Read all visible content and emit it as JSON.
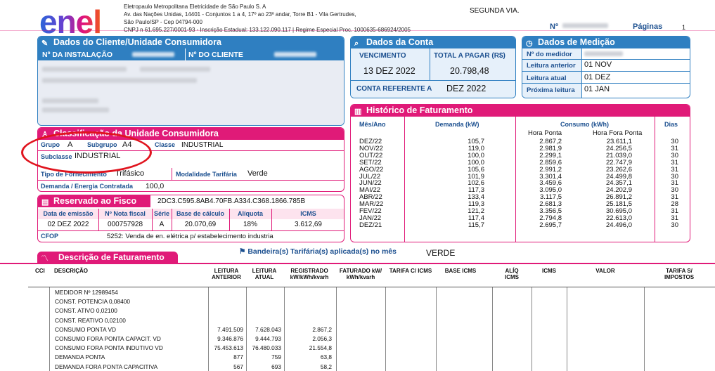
{
  "company": {
    "logo": "enel",
    "name": "Eletropaulo Metropolitana Eletricidade de São Paulo S. A",
    "address": "Av. das Nações Unidas, 14401 - Conjuntos 1 a 4, 17º ao 23º andar, Torre B1 - Vila Gertrudes,",
    "city": "São Paulo/SP - Cep 04794-000",
    "cnpj": "CNPJ n 61.695.227/0001-93 - Inscrição Estadual: 133.122.090.117 | Regime Especial Proc. 1000635-686924/2005"
  },
  "doc": {
    "segunda_via": "SEGUNDA VIA.",
    "n_label": "Nº",
    "paginas_label": "Páginas",
    "paginas_value": "1"
  },
  "cliente": {
    "title": "Dados do Cliente/Unidade Consumidora",
    "instalacao_label": "Nº DA INSTALAÇÃO",
    "cliente_label": "Nº DO CLIENTE"
  },
  "conta": {
    "title": "Dados da Conta",
    "vencimento_label": "VENCIMENTO",
    "vencimento": "13 DEZ 2022",
    "total_label": "TOTAL A PAGAR (R$)",
    "total": "20.798,48",
    "ref_label": "CONTA REFERENTE A",
    "ref": "DEZ 2022"
  },
  "medicao": {
    "title": "Dados de Medição",
    "medidor_label": "Nº do medidor",
    "anterior_label": "Leitura anterior",
    "anterior": "01 NOV",
    "atual_label": "Leitura atual",
    "atual": "01 DEZ",
    "proxima_label": "Próxima leitura",
    "proxima": "01 JAN"
  },
  "classificacao": {
    "title": "Classificação da Unidade Consumidora",
    "grupo_label": "Grupo",
    "grupo": "A",
    "subgrupo_label": "Subgrupo",
    "subgrupo": "A4",
    "classe_label": "Classe",
    "classe": "INDUSTRIAL",
    "subclasse_label": "Subclasse",
    "subclasse": "INDUSTRIAL",
    "tipo_label": "Tipo de Fornecimento",
    "tipo": "Trifásico",
    "modalidade_label": "Modalidade Tarifária",
    "modalidade": "Verde",
    "demanda_label": "Demanda / Energia Contratada",
    "demanda": "100,0"
  },
  "fisco": {
    "title": "Reservado ao Fisco",
    "code": "2DC3.C595.8AB4.70FB.A334.C368.1866.785B",
    "headers": [
      "Data de emissão",
      "Nº Nota fiscal",
      "Série",
      "Base de cálculo",
      "Alíquota",
      "ICMS"
    ],
    "values": [
      "02 DEZ 2022",
      "000757928",
      "A",
      "20.070,69",
      "18%",
      "3.612,69"
    ],
    "cfop_label": "CFOP",
    "cfop": "5252: Venda de en. elétrica p/ estabelecimento industria"
  },
  "historico": {
    "title": "Histórico de Faturamento",
    "mes_label": "Mês/Ano",
    "demanda_label": "Demanda (kW)",
    "consumo_label": "Consumo (kWh)",
    "hp_label": "Hora Ponta",
    "hfp_label": "Hora Fora Ponta",
    "dias_label": "Dias",
    "meses": [
      "DEZ/22",
      "NOV/22",
      "OUT/22",
      "SET/22",
      "AGO/22",
      "JUL/22",
      "JUN/22",
      "MAI/22",
      "ABR/22",
      "MAR/22",
      "FEV/22",
      "JAN/22",
      "DEZ/21"
    ],
    "demanda": [
      "105,7",
      "119,0",
      "100,0",
      "100,0",
      "105,6",
      "101,9",
      "102,6",
      "117,3",
      "133,4",
      "119,3",
      "121,2",
      "117,4",
      "115,7"
    ],
    "hp": [
      "2.867,2",
      "2.981,9",
      "2.299,1",
      "2.859,6",
      "2.991,2",
      "3.301,4",
      "3.459,6",
      "3.095,0",
      "3.117,5",
      "2.681,3",
      "3.356,5",
      "2.794,8",
      "2.695,7"
    ],
    "hfp": [
      "23.611,1",
      "24.256,5",
      "21.039,0",
      "22.747,9",
      "23.262,6",
      "24.499,8",
      "24.357,1",
      "24.202,9",
      "26.891,2",
      "25.181,5",
      "30.695,0",
      "22.613,0",
      "24.496,0"
    ],
    "dias": [
      "30",
      "31",
      "30",
      "31",
      "31",
      "30",
      "31",
      "30",
      "31",
      "28",
      "31",
      "31",
      "30"
    ]
  },
  "bandeira": {
    "label": "Bandeira(s) Tarifária(s) aplicada(s) no mês",
    "value": "VERDE"
  },
  "faturamento": {
    "title": "Descrição de Faturamento",
    "headers": {
      "cci": "CCI",
      "descricao": "DESCRIÇÃO",
      "leit_ant": "LEITURA\nANTERIOR",
      "leit_atual": "LEITURA\nATUAL",
      "registrado": "REGISTRADO\nkW/kWh/kvarh",
      "faturado": "FATURADO kW/\nkWh/kvarh",
      "tarifa_icms": "TARIFA C/ ICMS",
      "base_icms": "BASE ICMS",
      "aliq": "ALÍQ\nICMS",
      "icms": "ICMS",
      "valor": "VALOR",
      "tarifa_s": "TARIFA S/\nIMPOSTOS"
    },
    "rows": [
      {
        "desc": "MEDIDOR Nº 12989454",
        "ant": "",
        "atual": "",
        "reg": ""
      },
      {
        "desc": "CONST. POTENCIA 0,08400",
        "ant": "",
        "atual": "",
        "reg": ""
      },
      {
        "desc": "CONST. ATIVO    0,02100",
        "ant": "",
        "atual": "",
        "reg": ""
      },
      {
        "desc": "CONST. REATIVO  0,02100",
        "ant": "",
        "atual": "",
        "reg": ""
      },
      {
        "desc": "CONSUMO PONTA VD",
        "ant": "7.491.509",
        "atual": "7.628.043",
        "reg": "2.867,2"
      },
      {
        "desc": "CONSUMO FORA PONTA CAPACIT. VD",
        "ant": "9.346.876",
        "atual": "9.444.793",
        "reg": "2.056,3"
      },
      {
        "desc": "CONSUMO FORA PONTA INDUTIVO VD",
        "ant": "75.453.613",
        "atual": "76.480.033",
        "reg": "21.554,8"
      },
      {
        "desc": "DEMANDA PONTA",
        "ant": "877",
        "atual": "759",
        "reg": "63,8"
      },
      {
        "desc": "DEMANDA FORA PONTA CAPACITIVA",
        "ant": "567",
        "atual": "693",
        "reg": "58,2"
      }
    ]
  },
  "colors": {
    "blue": "#2f7fc1",
    "pink": "#e01a78",
    "annotation_red": "#e0141e"
  }
}
